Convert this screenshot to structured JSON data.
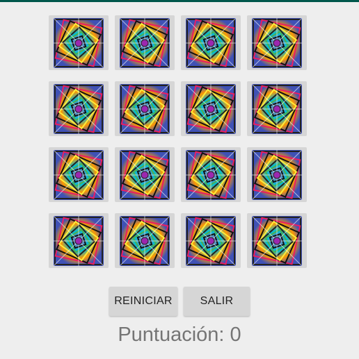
{
  "game": {
    "card_back_icon": "psychedelic-pattern-card-back",
    "cards": [
      {
        "state": "face-down"
      },
      {
        "state": "face-down"
      },
      {
        "state": "face-down"
      },
      {
        "state": "face-down"
      },
      {
        "state": "face-down"
      },
      {
        "state": "face-down"
      },
      {
        "state": "face-down"
      },
      {
        "state": "face-down"
      },
      {
        "state": "face-down"
      },
      {
        "state": "face-down"
      },
      {
        "state": "face-down"
      },
      {
        "state": "face-down"
      },
      {
        "state": "face-down"
      },
      {
        "state": "face-down"
      },
      {
        "state": "face-down"
      },
      {
        "state": "face-down"
      }
    ]
  },
  "controls": {
    "restart_label": "REINICIAR",
    "exit_label": "SALIR"
  },
  "score": {
    "text": "Puntuación: 0"
  },
  "colors": {
    "background": "#eeeeee",
    "accent_bar": "#00574b",
    "button": "#d6d6d6",
    "score_text": "#757575"
  }
}
